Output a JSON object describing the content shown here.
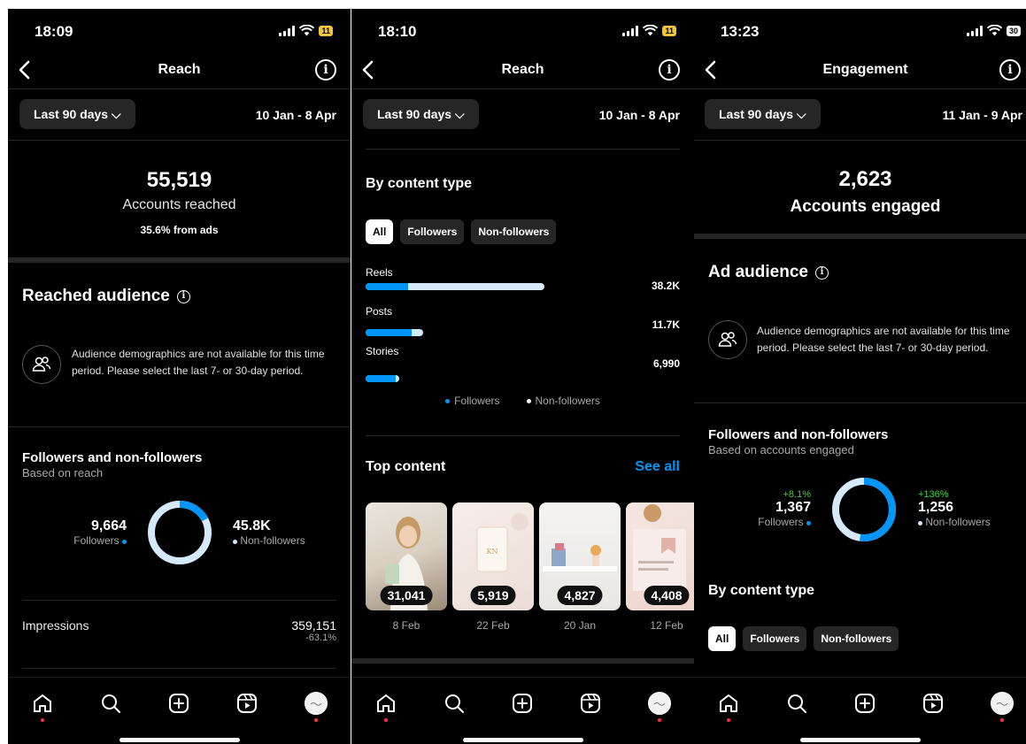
{
  "colors": {
    "accent": "#0095f6",
    "track": "#d6e9fb",
    "green": "#3cd23c",
    "notification": "#ff3040"
  },
  "screen1": {
    "time": "18:09",
    "battery": "11",
    "title": "Reach",
    "period": "Last 90 days",
    "date_range": "10 Jan - 8 Apr",
    "accounts_reached": "55,519",
    "accounts_reached_label": "Accounts reached",
    "from_ads": "35.6% from ads",
    "reached_audience": "Reached audience",
    "demographics_note": "Audience demographics are not available for this time period. Please select the last 7- or 30-day period.",
    "fnf_title": "Followers and non-followers",
    "fnf_sub": "Based on reach",
    "followers_value": "9,664",
    "followers_label": "Followers",
    "nonfollowers_value": "45.8K",
    "nonfollowers_label": "Non-followers",
    "followers_share": 0.174,
    "impressions_label": "Impressions",
    "impressions_value": "359,151",
    "impressions_change": "-63.1%"
  },
  "screen2": {
    "time": "18:10",
    "battery": "11",
    "title": "Reach",
    "period": "Last 90 days",
    "date_range": "10 Jan - 8 Apr",
    "by_content_type": "By content type",
    "filters": [
      "All",
      "Followers",
      "Non-followers"
    ],
    "content_bars": [
      {
        "label": "Reels",
        "value": "38.2K",
        "total_frac": 1.0,
        "followers_frac": 0.24
      },
      {
        "label": "Posts",
        "value": "11.7K",
        "total_frac": 0.32,
        "followers_frac": 0.8
      },
      {
        "label": "Stories",
        "value": "6,990",
        "total_frac": 0.19,
        "followers_frac": 0.9
      }
    ],
    "legend_followers": "Followers",
    "legend_nonfollowers": "Non-followers",
    "top_content": "Top content",
    "see_all": "See all",
    "top_items": [
      {
        "count": "31,041",
        "date": "8 Feb"
      },
      {
        "count": "5,919",
        "date": "22 Feb"
      },
      {
        "count": "4,827",
        "date": "20 Jan"
      },
      {
        "count": "4,408",
        "date": "12 Feb"
      }
    ]
  },
  "screen3": {
    "time": "13:23",
    "battery": "30",
    "title": "Engagement",
    "period": "Last 90 days",
    "date_range": "11 Jan - 9 Apr",
    "accounts_engaged": "2,623",
    "accounts_engaged_label": "Accounts engaged",
    "ad_audience": "Ad audience",
    "demographics_note": "Audience demographics are not available for this time period. Please select the last 7- or 30-day period.",
    "fnf_title": "Followers and non-followers",
    "fnf_sub": "Based on accounts engaged",
    "followers_change": "+8.1%",
    "followers_value": "1,367",
    "followers_label": "Followers",
    "nonfollowers_change": "+136%",
    "nonfollowers_value": "1,256",
    "nonfollowers_label": "Non-followers",
    "followers_share": 0.521,
    "by_content_type": "By content type",
    "filters": [
      "All",
      "Followers",
      "Non-followers"
    ]
  },
  "tabbar_icons": [
    "home-icon",
    "search-icon",
    "create-icon",
    "reels-icon",
    "profile-avatar"
  ]
}
